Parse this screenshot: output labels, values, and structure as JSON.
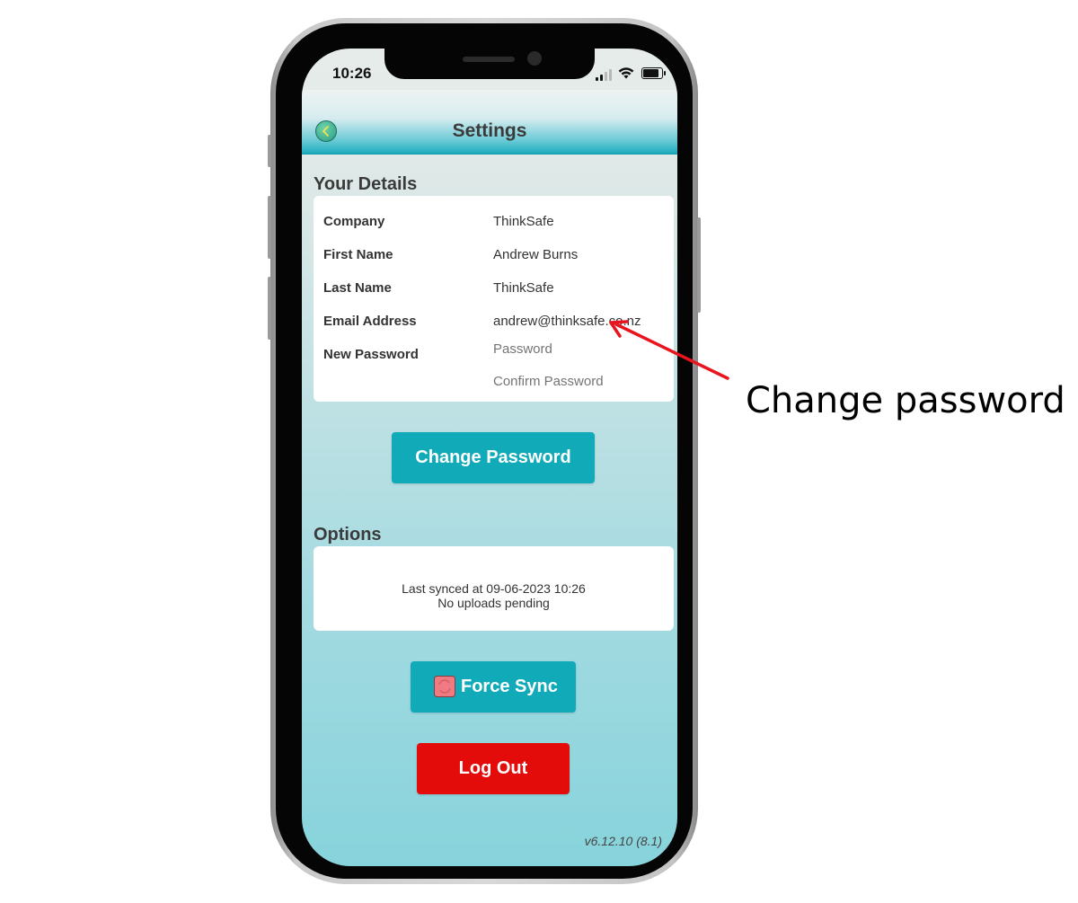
{
  "status_bar": {
    "time": "10:26"
  },
  "header": {
    "title": "Settings",
    "back_icon": "chevron-left-icon"
  },
  "your_details": {
    "section_title": "Your Details",
    "rows": [
      {
        "label": "Company",
        "value": "ThinkSafe"
      },
      {
        "label": "First Name",
        "value": "Andrew Burns"
      },
      {
        "label": "Last Name",
        "value": "ThinkSafe"
      },
      {
        "label": "Email Address",
        "value": "andrew@thinksafe.co.nz"
      }
    ],
    "new_password": {
      "label": "New Password",
      "password_placeholder": "Password",
      "confirm_placeholder": "Confirm Password",
      "password_value": "",
      "confirm_value": ""
    }
  },
  "change_password_button": {
    "label": "Change Password"
  },
  "options": {
    "section_title": "Options",
    "last_synced": "Last synced at 09-06-2023 10:26",
    "uploads_status": "No uploads pending"
  },
  "force_sync_button": {
    "label": "Force Sync",
    "icon": "sync-icon"
  },
  "logout_button": {
    "label": "Log Out"
  },
  "version": "v6.12.10 (8.1)",
  "annotation": {
    "text": "Change password"
  },
  "colors": {
    "teal_button": "#11aab8",
    "logout_red": "#e40b0b",
    "annotation_arrow": "#e8141e"
  }
}
